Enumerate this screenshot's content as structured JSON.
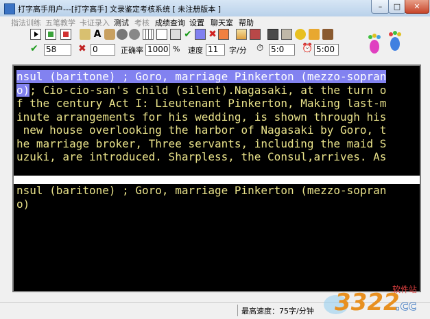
{
  "window": {
    "title": "打字高手用户---[打字高手]      文录鉴定考核系统 [ 未注册版本 ]"
  },
  "menu": {
    "items": [
      {
        "label": "指法训练",
        "enabled": false
      },
      {
        "label": "五笔教学",
        "enabled": false
      },
      {
        "label": "卡证录入",
        "enabled": false
      },
      {
        "label": "测试",
        "enabled": true
      },
      {
        "label": "考核",
        "enabled": false
      },
      {
        "label": "成绩查询",
        "enabled": true
      },
      {
        "label": "设置",
        "enabled": true
      },
      {
        "label": "聊天室",
        "enabled": true
      },
      {
        "label": "帮助",
        "enabled": true
      }
    ]
  },
  "stats": {
    "correct": "58",
    "errors": "0",
    "accuracy_label": "正确率",
    "accuracy_value": "1000",
    "accuracy_unit": "%",
    "speed_label": "速度",
    "speed_value": "11",
    "speed_unit": "字/分",
    "elapsed": "5:0",
    "limit": "5:00"
  },
  "reference_text": {
    "line1_highlight": "nsul (baritone) ; Goro, marriage Pinkerton (mezzo-sopran",
    "line2_highlight": "o)",
    "line2_rest": "; Cio-cio-san's child (silent).Nagasaki, at the turn o",
    "line3": "f the century Act I: Lieutenant Pinkerton, Making last-m",
    "line4": "inute arrangements for his wedding, is shown through his",
    "line5": " new house overlooking the harbor of Nagasaki by Goro, t",
    "line6": "he marriage broker, Three servants, including the maid S",
    "line7": "uzuki, are introduced. Sharpless, the Consul,arrives. As"
  },
  "typed_text": {
    "line1": "nsul (baritone) ; Goro, marriage Pinkerton (mezzo-sopran",
    "line2": "o)"
  },
  "status": {
    "max_speed": "最高速度：75字/分钟"
  },
  "watermark": {
    "brand": "3322",
    "suffix": ".cc",
    "tagline": "软件站"
  },
  "colors": {
    "text": "#e9e28a",
    "highlight": "#8282f0",
    "panel_bg": "#000000"
  }
}
